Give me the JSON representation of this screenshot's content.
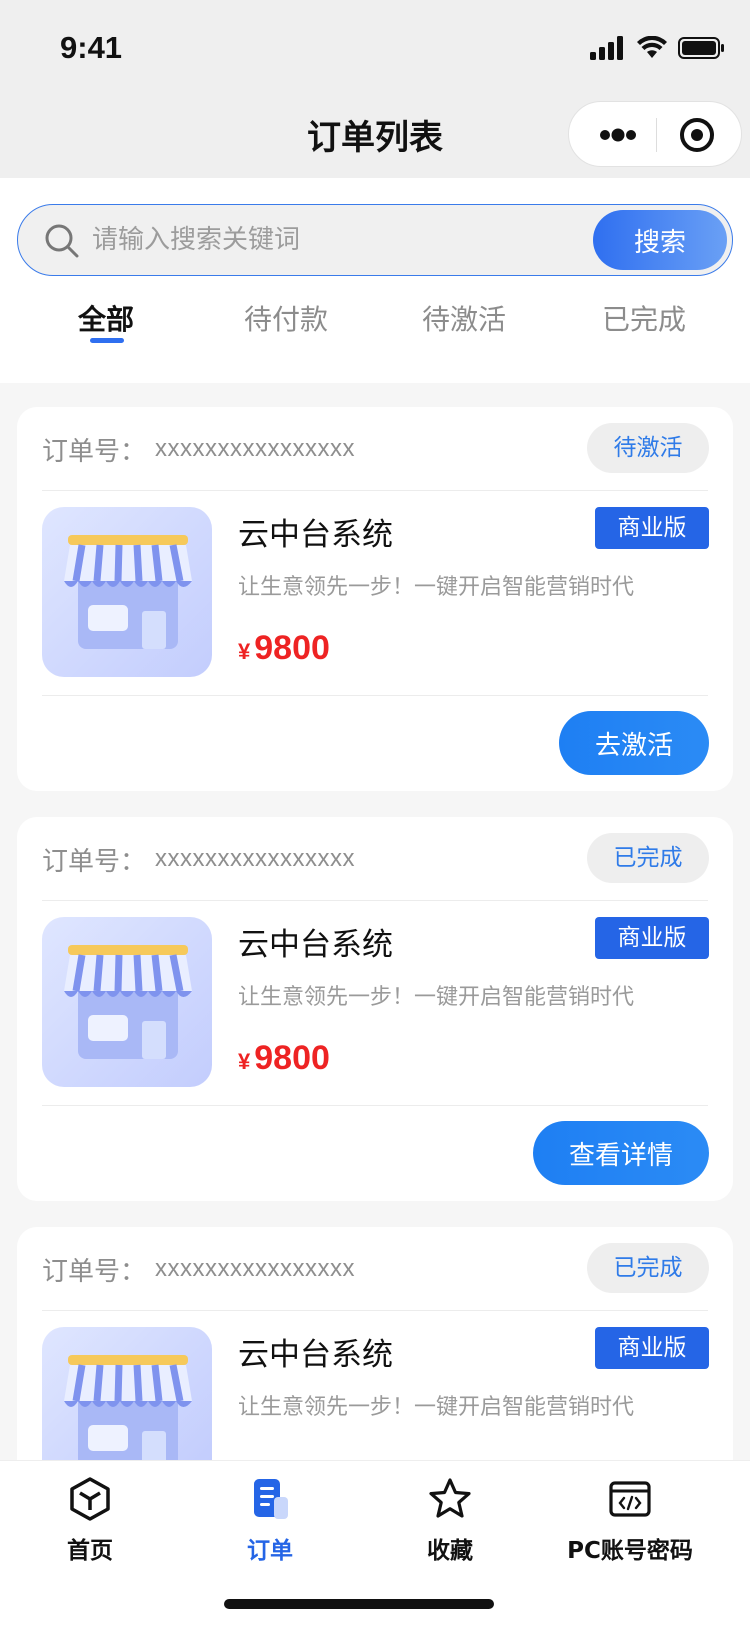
{
  "status_bar": {
    "time": "9:41"
  },
  "nav": {
    "title": "订单列表"
  },
  "search": {
    "placeholder": "请输入搜索关键词",
    "button_label": "搜索"
  },
  "tabs": [
    {
      "label": "全部",
      "active": true
    },
    {
      "label": "待付款",
      "active": false
    },
    {
      "label": "待激活",
      "active": false
    },
    {
      "label": "已完成",
      "active": false
    }
  ],
  "orders": [
    {
      "order_label": "订单号：",
      "order_no": "xxxxxxxxxxxxxxxx",
      "status": "待激活",
      "product_name": "云中台系统",
      "edition": "商业版",
      "description": "让生意领先一步！一键开启智能营销时代",
      "currency": "¥",
      "price": "9800",
      "action": "去激活"
    },
    {
      "order_label": "订单号：",
      "order_no": "xxxxxxxxxxxxxxxx",
      "status": "已完成",
      "product_name": "云中台系统",
      "edition": "商业版",
      "description": "让生意领先一步！一键开启智能营销时代",
      "currency": "¥",
      "price": "9800",
      "action": "查看详情"
    },
    {
      "order_label": "订单号：",
      "order_no": "xxxxxxxxxxxxxxxx",
      "status": "已完成",
      "product_name": "云中台系统",
      "edition": "商业版",
      "description": "让生意领先一步！一键开启智能营销时代"
    }
  ],
  "tabbar": [
    {
      "label": "首页",
      "icon": "home-icon",
      "active": false
    },
    {
      "label": "订单",
      "icon": "order-icon",
      "active": true
    },
    {
      "label": "收藏",
      "icon": "star-icon",
      "active": false
    },
    {
      "label": "PC账号密码",
      "icon": "code-window-icon",
      "active": false
    }
  ],
  "colors": {
    "accent": "#2565e6",
    "price": "#ee2323",
    "status_text": "#2f7be8"
  }
}
